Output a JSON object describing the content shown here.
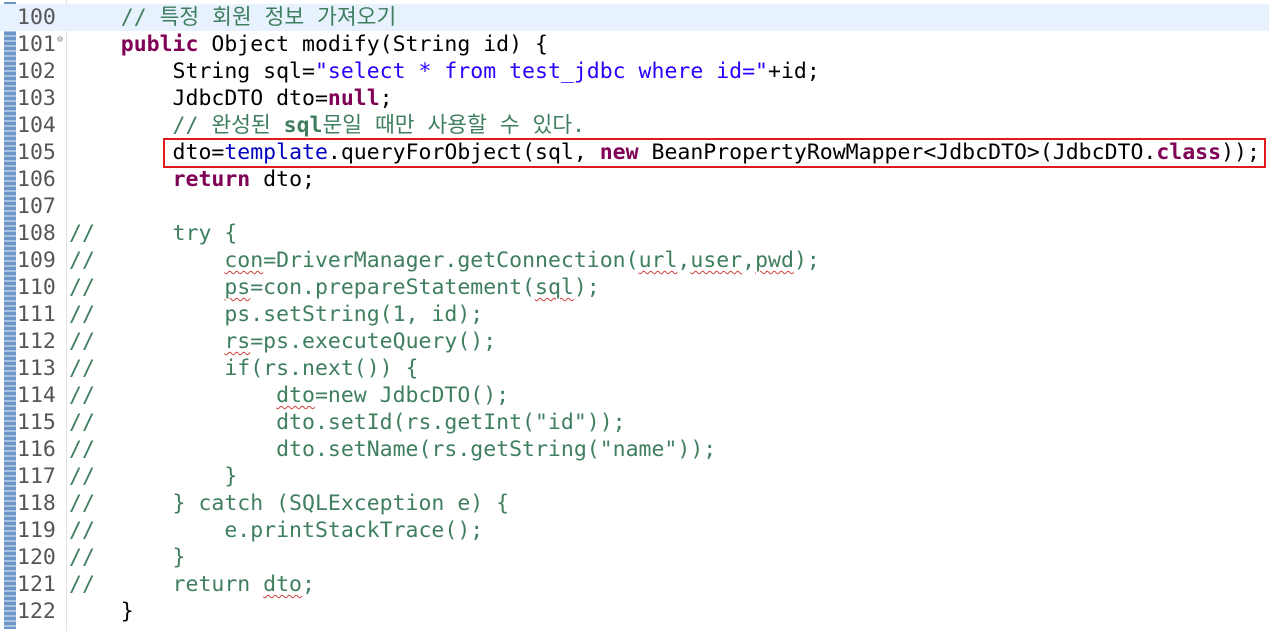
{
  "editor": {
    "lines": [
      {
        "n": "100",
        "t": "    // 특정 회원 정보 가져오기"
      },
      {
        "n": "101",
        "t": "    public Object modify(String id) {"
      },
      {
        "n": "102",
        "t": "        String sql=\"select * from test_jdbc where id=\"+id;"
      },
      {
        "n": "103",
        "t": "        JdbcDTO dto=null;"
      },
      {
        "n": "104",
        "t": "        // 완성된 sql문일 때만 사용할 수 있다."
      },
      {
        "n": "105",
        "t": "        dto=template.queryForObject(sql, new BeanPropertyRowMapper<JdbcDTO>(JdbcDTO.class));"
      },
      {
        "n": "106",
        "t": "        return dto;"
      },
      {
        "n": "107",
        "t": ""
      },
      {
        "n": "108",
        "t": "//      try {"
      },
      {
        "n": "109",
        "t": "//          con=DriverManager.getConnection(url,user,pwd);"
      },
      {
        "n": "110",
        "t": "//          ps=con.prepareStatement(sql);"
      },
      {
        "n": "111",
        "t": "//          ps.setString(1, id);"
      },
      {
        "n": "112",
        "t": "//          rs=ps.executeQuery();"
      },
      {
        "n": "113",
        "t": "//          if(rs.next()) {"
      },
      {
        "n": "114",
        "t": "//              dto=new JdbcDTO();"
      },
      {
        "n": "115",
        "t": "//              dto.setId(rs.getInt(\"id\"));"
      },
      {
        "n": "116",
        "t": "//              dto.setName(rs.getString(\"name\"));"
      },
      {
        "n": "117",
        "t": "//          }"
      },
      {
        "n": "118",
        "t": "//      } catch (SQLException e) {"
      },
      {
        "n": "119",
        "t": "//          e.printStackTrace();"
      },
      {
        "n": "120",
        "t": "//      }"
      },
      {
        "n": "121",
        "t": "//      return dto;"
      },
      {
        "n": "122",
        "t": "    }"
      }
    ],
    "fold_marker": "⊖",
    "colors": {
      "comment": "#3f7f5f",
      "keyword": "#7f0055",
      "string": "#2a00ff",
      "field": "#0000c0",
      "highlight_border": "#e01a1a",
      "current_line": "#e8f2fe"
    }
  }
}
